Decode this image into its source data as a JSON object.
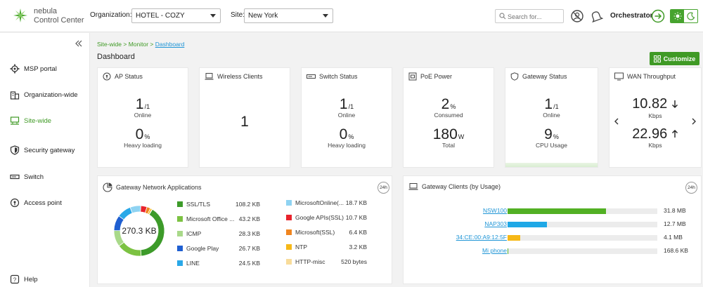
{
  "header": {
    "brand_line1": "nebula",
    "brand_line2": "Control Center",
    "org_label": "Organization:",
    "org_value": "HOTEL - COZY",
    "site_label": "Site:",
    "site_value": "New York",
    "search_placeholder": "Search for...",
    "orchestrator_label": "Orchestrator"
  },
  "sidebar": {
    "items": [
      {
        "label": "MSP portal",
        "icon": "gear-icon"
      },
      {
        "label": "Organization-wide",
        "icon": "building-icon"
      },
      {
        "label": "Site-wide",
        "icon": "site-icon"
      },
      {
        "label": "Security gateway",
        "icon": "shield-icon"
      },
      {
        "label": "Switch",
        "icon": "switch-icon"
      },
      {
        "label": "Access point",
        "icon": "access-point-icon"
      }
    ],
    "help_label": "Help"
  },
  "breadcrumb": {
    "part1": "Site-wide",
    "part2": "Monitor",
    "part3": "Dashboard",
    "sep": ">"
  },
  "page_title": "Dashboard",
  "customize_label": "Customize",
  "cards": {
    "ap": {
      "title": "AP Status",
      "n1": "1",
      "n1_sub": "/1",
      "l1": "Online",
      "n2": "0",
      "n2_sub": "%",
      "l2": "Heavy loading"
    },
    "wireless": {
      "title": "Wireless Clients",
      "n1": "1"
    },
    "switch": {
      "title": "Switch Status",
      "n1": "1",
      "n1_sub": "/1",
      "l1": "Online",
      "n2": "0",
      "n2_sub": "%",
      "l2": "Heavy loading"
    },
    "poe": {
      "title": "PoE Power",
      "n1": "2",
      "n1_sub": "%",
      "l1": "Consumed",
      "n2": "180",
      "n2_sub": "W",
      "l2": "Total"
    },
    "gateway": {
      "title": "Gateway Status",
      "n1": "1",
      "n1_sub": "/1",
      "l1": "Online",
      "n2": "9",
      "n2_sub": "%",
      "l2": "CPU Usage"
    },
    "wan": {
      "title": "WAN Throughput",
      "down": "10.82",
      "down_unit": "Kbps",
      "up": "22.96",
      "up_unit": "Kbps"
    }
  },
  "apps": {
    "title": "Gateway Network Applications",
    "badge": "24h",
    "total": "270.3 KB",
    "items": [
      {
        "name": "SSL/TLS",
        "value": "108.2 KB",
        "color": "#3d9b2a",
        "share": 108.2
      },
      {
        "name": "Microsoft Office ...",
        "value": "43.2 KB",
        "color": "#7cc242",
        "share": 43.2
      },
      {
        "name": "ICMP",
        "value": "28.3 KB",
        "color": "#a9d98a",
        "share": 28.3
      },
      {
        "name": "Google Play",
        "value": "26.7 KB",
        "color": "#1f5fd1",
        "share": 26.7
      },
      {
        "name": "LINE",
        "value": "24.5 KB",
        "color": "#29a8e8",
        "share": 24.5
      },
      {
        "name": "MicrosoftOnline(...",
        "value": "18.7 KB",
        "color": "#8fd3f2",
        "share": 18.7
      },
      {
        "name": "Google APIs(SSL)",
        "value": "10.7 KB",
        "color": "#e8232c",
        "share": 10.7
      },
      {
        "name": "Microsoft(SSL)",
        "value": "6.4 KB",
        "color": "#f0851f",
        "share": 6.4
      },
      {
        "name": "NTP",
        "value": "3.2 KB",
        "color": "#f6b817",
        "share": 3.2
      },
      {
        "name": "HTTP-misc",
        "value": "520 bytes",
        "color": "#f8dc9a",
        "share": 0.5
      }
    ]
  },
  "clients": {
    "title": "Gateway Clients (by Usage)",
    "badge": "24h",
    "rows": [
      {
        "name": "NSW100",
        "value": "31.8 MB",
        "fraction": 1.0,
        "color": "#52b024"
      },
      {
        "name": "NAP303",
        "value": "12.7 MB",
        "fraction": 0.4,
        "color": "#1fa8e6"
      },
      {
        "name": "34:CE:00:A9:12:5F",
        "value": "4.1 MB",
        "fraction": 0.13,
        "color": "#f6b817"
      },
      {
        "name": "Mi phone",
        "value": "168.6 KB",
        "fraction": 0.005,
        "color": "#52b024"
      }
    ]
  }
}
